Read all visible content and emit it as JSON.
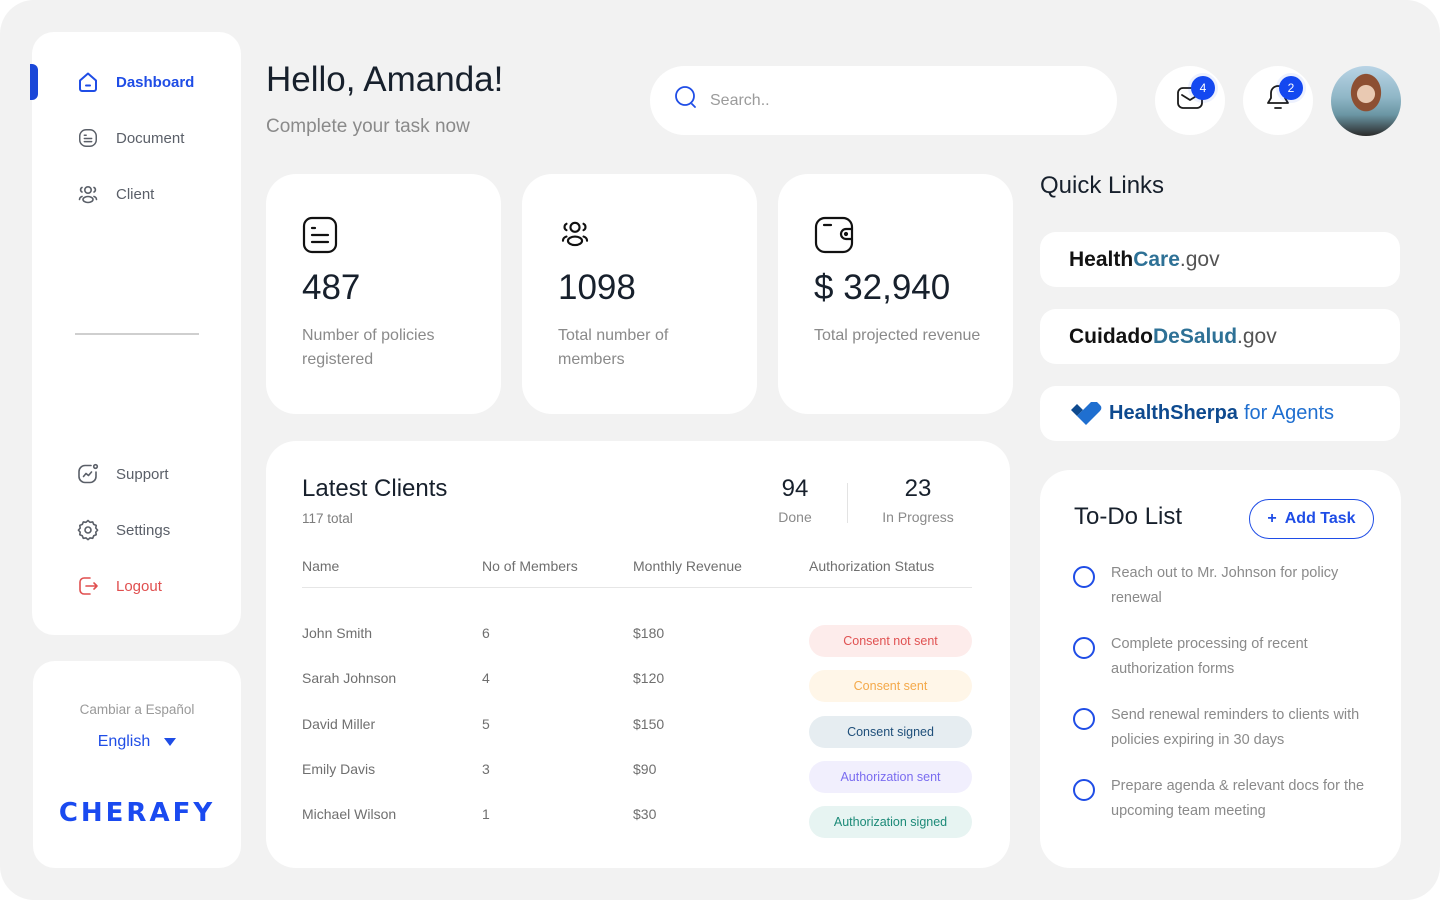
{
  "sidebar": {
    "items": [
      {
        "label": "Dashboard",
        "icon": "home-icon",
        "active": true
      },
      {
        "label": "Document",
        "icon": "document-icon"
      },
      {
        "label": "Client",
        "icon": "users-icon"
      },
      {
        "label": "Support",
        "icon": "chart-support-icon"
      },
      {
        "label": "Settings",
        "icon": "gear-icon"
      },
      {
        "label": "Logout",
        "icon": "logout-icon"
      }
    ],
    "accent_color": "#1f4de6",
    "logout_color": "#e04f4f"
  },
  "language": {
    "title": "Cambiar a Español",
    "selected": "English"
  },
  "brand": {
    "logo_text": "CHERAFY",
    "color": "#1a4af0"
  },
  "header": {
    "greeting": "Hello, Amanda!",
    "subtitle": "Complete your task now",
    "search_placeholder": "Search..",
    "messages_count": "4",
    "notifications_count": "2"
  },
  "stats": [
    {
      "value": "487",
      "label": "Number of policies registered",
      "icon": "document-icon"
    },
    {
      "value": "1098",
      "label": "Total number of members",
      "icon": "users-icon"
    },
    {
      "value": "$ 32,940",
      "label": "Total projected revenue",
      "icon": "wallet-icon"
    }
  ],
  "clients": {
    "title": "Latest Clients",
    "total": "117 total",
    "done_count": "94",
    "done_label": "Done",
    "in_progress_count": "23",
    "in_progress_label": "In Progress",
    "columns": [
      "Name",
      "No of Members",
      "Monthly Revenue",
      "Authorization Status"
    ],
    "rows": [
      {
        "name": "John Smith",
        "members": "6",
        "revenue": "$180",
        "status": "Consent not sent",
        "status_color": "#e05252",
        "status_bg": "#fdeceb"
      },
      {
        "name": "Sarah Johnson",
        "members": "4",
        "revenue": "$120",
        "status": "Consent sent",
        "status_color": "#f4a94a",
        "status_bg": "#fff6e8"
      },
      {
        "name": "David Miller",
        "members": "5",
        "revenue": "$150",
        "status": "Consent  signed",
        "status_color": "#1f4f7a",
        "status_bg": "#e6edf1"
      },
      {
        "name": "Emily Davis",
        "members": "3",
        "revenue": "$90",
        "status": "Authorization sent",
        "status_color": "#7a6cf0",
        "status_bg": "#f1effd"
      },
      {
        "name": "Michael Wilson",
        "members": "1",
        "revenue": "$30",
        "status": "Authorization signed",
        "status_color": "#1c8a78",
        "status_bg": "#e7f4f2"
      }
    ]
  },
  "quick_links": {
    "title": "Quick Links",
    "items": [
      {
        "part1": "Health",
        "part2": "Care",
        "part3": ".gov"
      },
      {
        "part1": "Cuidado",
        "part2": "DeSalud",
        "part3": ".gov"
      },
      {
        "part1": "HealthSherpa",
        "part2": "for Agents"
      }
    ]
  },
  "todo": {
    "title": "To-Do List",
    "add_label": "Add Task",
    "add_symbol": "+",
    "items": [
      "Reach out to Mr. Johnson for policy renewal",
      "Complete processing of recent authorization forms",
      "Send renewal reminders to clients with policies expiring in 30 days",
      "Prepare agenda & relevant docs for the upcoming team meeting"
    ]
  }
}
